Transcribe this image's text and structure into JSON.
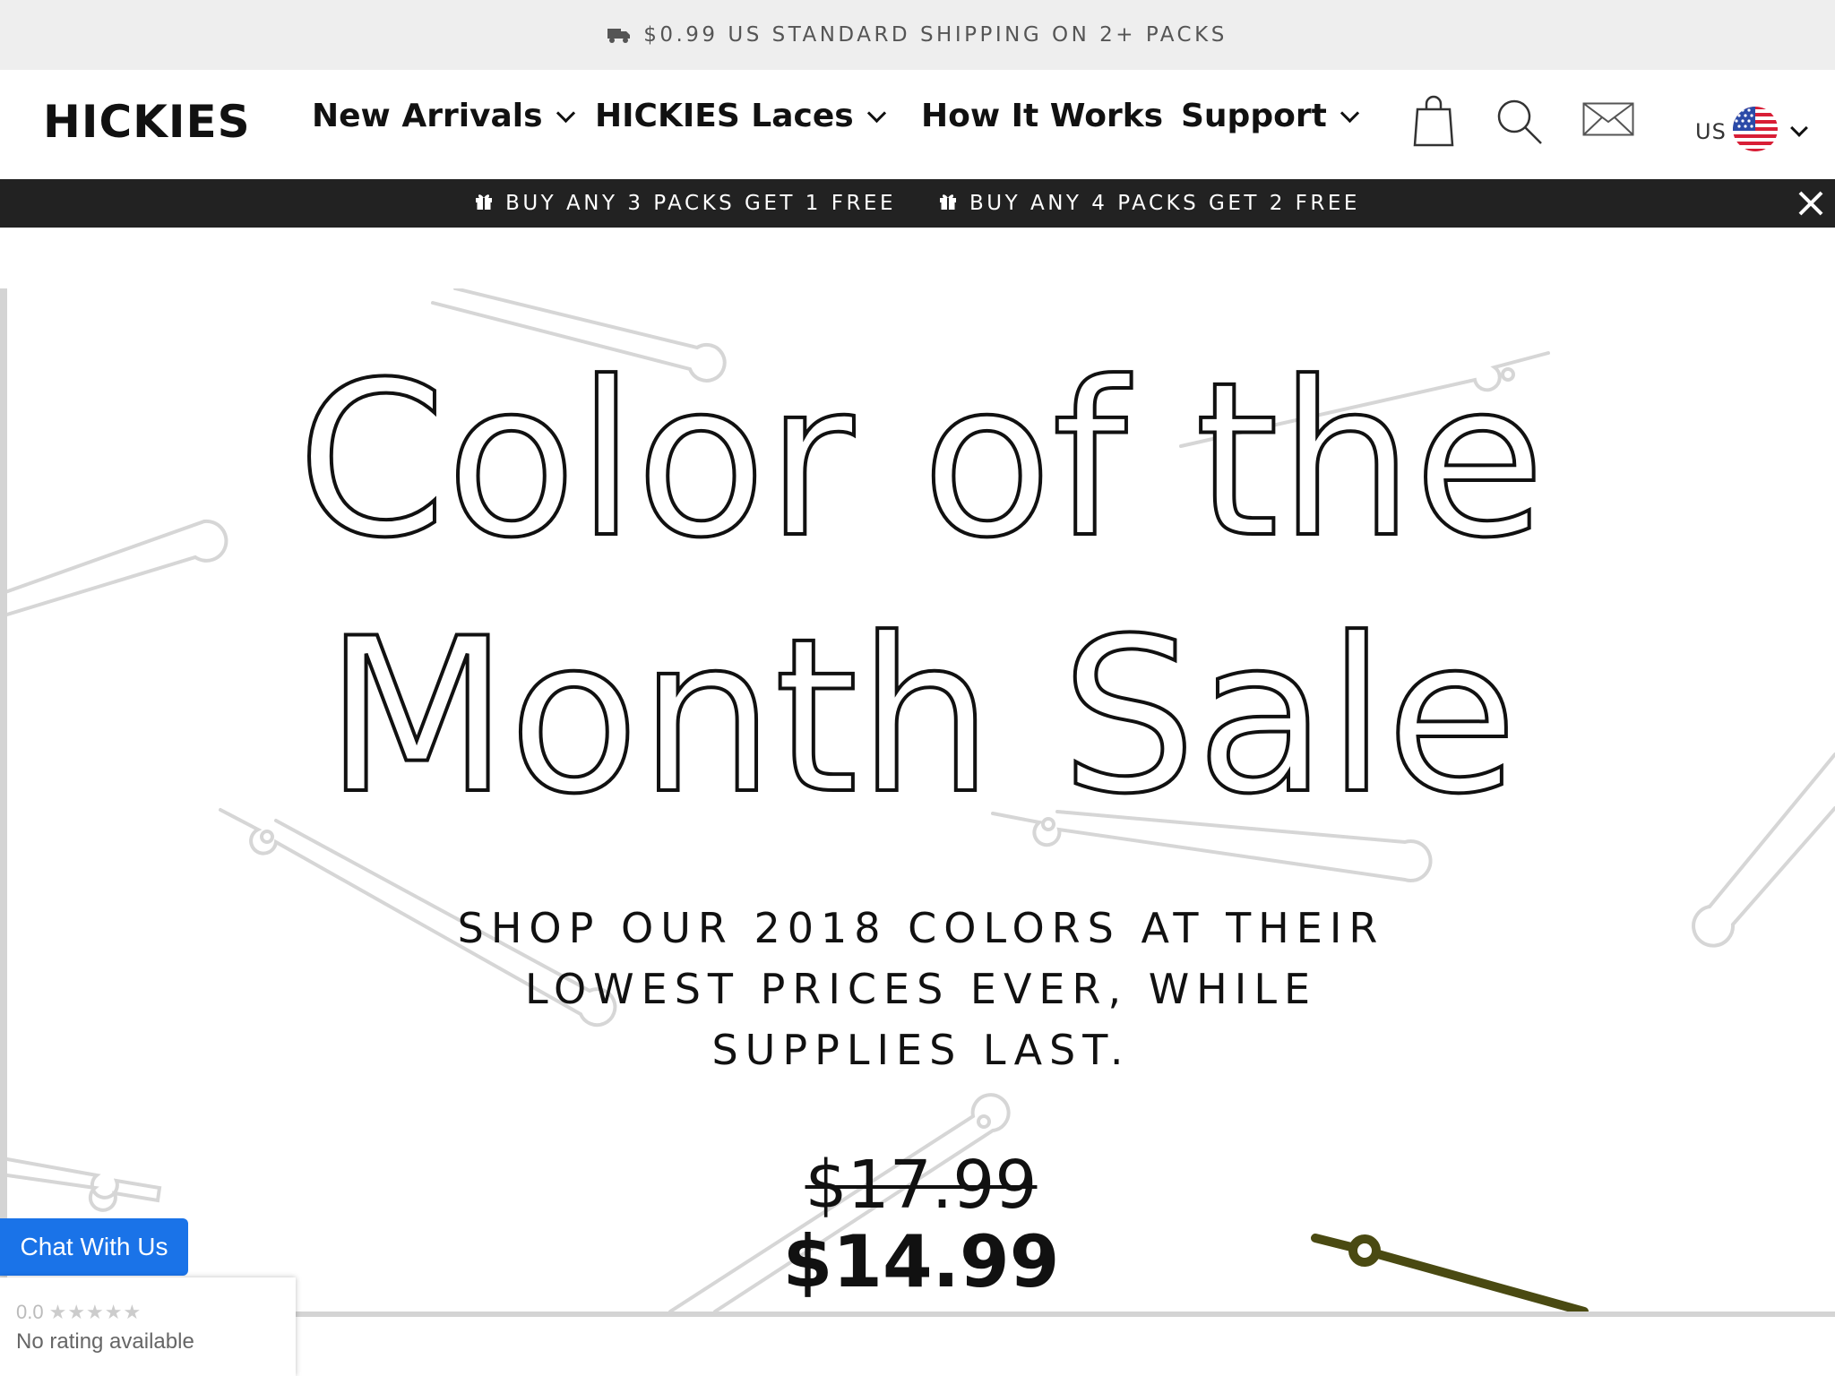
{
  "shipping_bar": {
    "icon": "truck-icon",
    "text": "$0.99 US STANDARD SHIPPING ON 2+ PACKS"
  },
  "header": {
    "logo": "HICKIES",
    "nav": [
      {
        "label": "New Arrivals",
        "has_dropdown": true
      },
      {
        "label": "HICKIES Laces",
        "has_dropdown": true
      },
      {
        "label": "How It Works",
        "has_dropdown": false
      },
      {
        "label": "Support",
        "has_dropdown": true
      }
    ],
    "icons": [
      "shopping-bag-icon",
      "search-icon",
      "mail-icon"
    ],
    "currency": {
      "code": "US",
      "flag": "us-flag-icon"
    }
  },
  "promo_bar": {
    "items": [
      {
        "icon": "gift-icon",
        "text": "BUY ANY 3 PACKS GET 1 FREE"
      },
      {
        "icon": "gift-icon",
        "text": "BUY ANY 4 PACKS GET 2 FREE"
      }
    ],
    "close_icon": "close-icon"
  },
  "hero": {
    "title_line1": "Color of the",
    "title_line2": "Month Sale",
    "subtitle_line1": "SHOP OUR 2018 COLORS AT THEIR",
    "subtitle_line2": "LOWEST PRICES EVER, WHILE",
    "subtitle_line3": "SUPPLIES LAST.",
    "old_price": "$17.99",
    "new_price": "$14.99",
    "accent_lace_color": "#4a4a12"
  },
  "chat": {
    "label": "Chat With Us",
    "color": "#1a73e8"
  },
  "rating": {
    "score": "0.0",
    "stars": "★★★★★",
    "text": "No rating available"
  }
}
